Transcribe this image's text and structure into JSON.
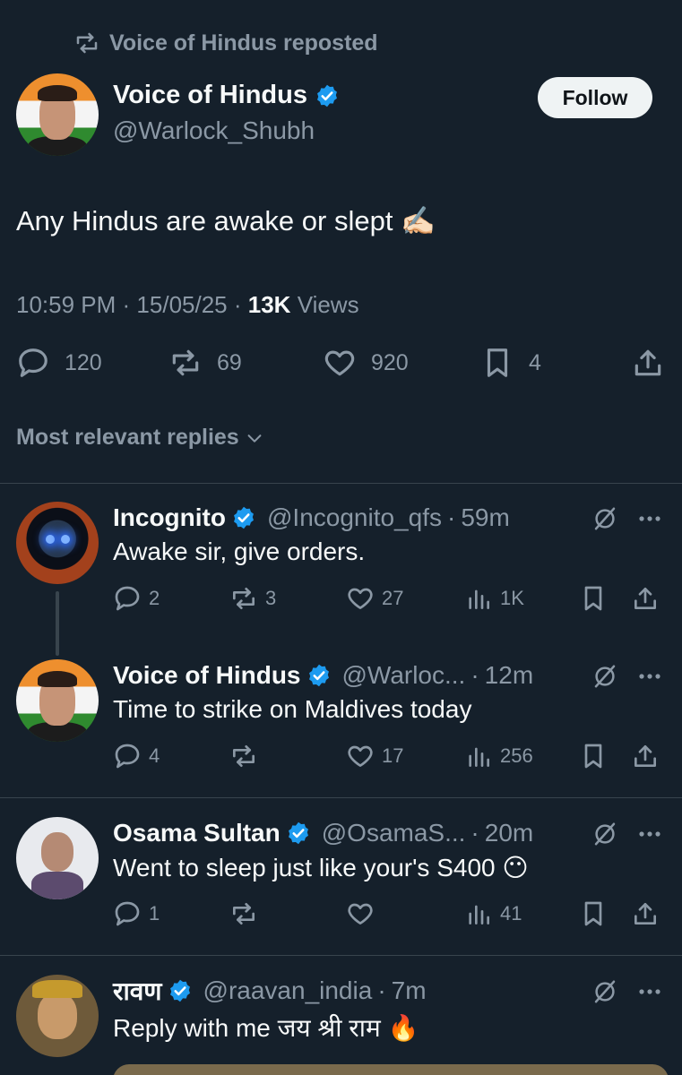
{
  "repost": {
    "text": "Voice of Hindus reposted"
  },
  "tweet": {
    "name": "Voice of Hindus",
    "handle": "@Warlock_Shubh",
    "follow_label": "Follow",
    "text": "Any Hindus are awake or slept ✍🏻",
    "time": "10:59 PM",
    "date": "15/05/25",
    "views_count": "13K",
    "views_label": "Views",
    "stats": {
      "replies": "120",
      "reposts": "69",
      "likes": "920",
      "bookmarks": "4"
    }
  },
  "replies_filter": {
    "label": "Most relevant replies"
  },
  "replies": [
    {
      "name": "Incognito",
      "handle": "@Incognito_qfs",
      "time": "59m",
      "text": "Awake sir, give orders.",
      "stats": {
        "replies": "2",
        "reposts": "3",
        "likes": "27",
        "views": "1K"
      }
    },
    {
      "name": "Voice of Hindus",
      "handle": "@Warloc...",
      "time": "12m",
      "text": "Time to strike on Maldives today",
      "stats": {
        "replies": "4",
        "reposts": "",
        "likes": "17",
        "views": "256"
      }
    },
    {
      "name": "Osama Sultan",
      "handle": "@OsamaS...",
      "time": "20m",
      "text": "Went to sleep just like your's S400 😶",
      "stats": {
        "replies": "1",
        "reposts": "",
        "likes": "",
        "views": "41"
      }
    },
    {
      "name": "रावण",
      "handle": "@raavan_india",
      "time": "7m",
      "text": "Reply with me जय श्री राम 🔥"
    }
  ],
  "colors": {
    "background": "#15202b",
    "muted": "#8b98a5",
    "verified": "#1d9bf0",
    "divider": "#38444d"
  }
}
